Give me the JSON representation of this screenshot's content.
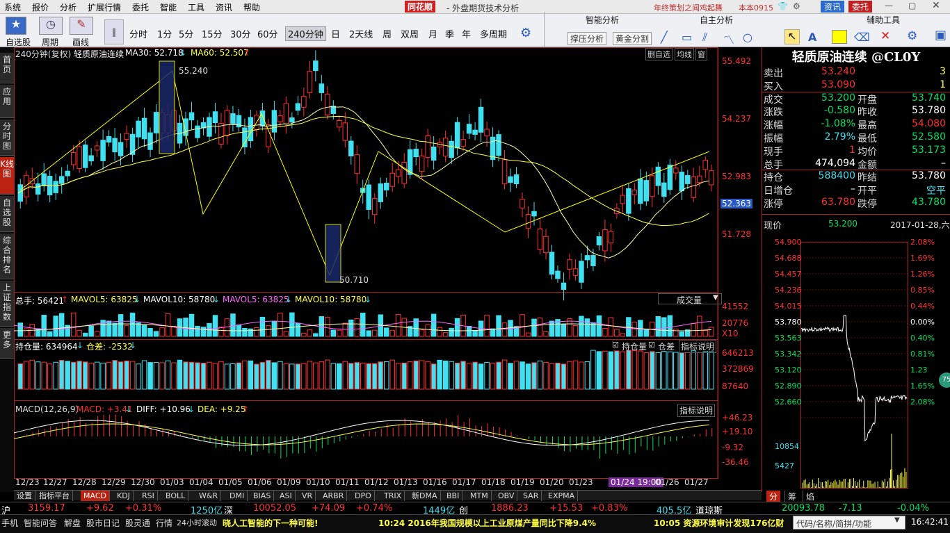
{
  "menu": [
    "系统",
    "报价",
    "分析",
    "扩展行情",
    "委托",
    "智能",
    "工具",
    "资讯",
    "帮助"
  ],
  "app_logo": "同花顺",
  "window_title": "- 外盘期货技术分析",
  "promo": "年终策划之闻鸡起舞",
  "user": "本本0915",
  "btn_zixun": "资讯",
  "btn_weituo": "委托",
  "toolbar": {
    "zixuan": "自选股",
    "zhouqi": "周期",
    "huaxian": "画线",
    "periods": [
      "分时",
      "1分",
      "5分",
      "15分",
      "30分",
      "60分",
      "240分钟",
      "日",
      "2天线",
      "周",
      "双周",
      "月",
      "季",
      "年",
      "多周期"
    ],
    "zhineng_title": "智能分析",
    "yashi": "撑压分析",
    "huangjin": "黄金分割",
    "zizhu_title": "自主分析",
    "fuzhu_title": "辅助工具"
  },
  "sidebar": [
    {
      "label": "首页"
    },
    {
      "label": "应用"
    },
    {
      "label": "分时图"
    },
    {
      "label": "K线图"
    },
    {
      "label": "自选股"
    },
    {
      "label": "综合排名"
    },
    {
      "label": "上证指数"
    },
    {
      "label": "更多"
    }
  ],
  "chart": {
    "header": "240分钟(复权)",
    "name": "轻质原油连续",
    "ma30": "MA30: 52.718",
    "ma60": "MA60: 52.507",
    "top_btns": [
      "删自选",
      "均线",
      "窗"
    ],
    "high_label": "55.240",
    "low_label": "50.710",
    "price_axis": [
      "55.492",
      "54.237",
      "52.983",
      "51.728"
    ],
    "current_price": "52.363",
    "vol_header": {
      "total": "总手: 56421",
      "mavol5": "MAVOL5: 63825",
      "mavol10": "MAVOL10: 58780",
      "mavol5b": "MAVOL5: 63825",
      "mavol10b": "MAVOL10: 58780"
    },
    "vol_dropdown": "成交量",
    "vol_axis": [
      "41552",
      "20776",
      "X10"
    ],
    "oi_header": {
      "oi": "持仓量: 634964",
      "diff": "仓差: -2532"
    },
    "oi_checks": [
      "持仓量",
      "仓差"
    ],
    "oi_help": "指标说明",
    "oi_axis": [
      "646213",
      "372869",
      "87640"
    ],
    "macd_header": {
      "name": "MACD(12,26,9)",
      "macd": "MACD: +3.41",
      "diff": "DIFF: +10.96",
      "dea": "DEA: +9.25"
    },
    "macd_help": "指标说明",
    "macd_axis": [
      "+46.23",
      "+19.10",
      "-9.32",
      "-36.46"
    ],
    "dates": [
      "12/23",
      "12/27",
      "12/28",
      "12/29",
      "12/30",
      "01/03",
      "01/04",
      "01/05",
      "01/06",
      "01/09",
      "01/10",
      "01/11",
      "01/12",
      "01/13",
      "01/16",
      "01/17",
      "01/18",
      "01/19",
      "01/20",
      "01/23",
      "01/24 19:00",
      "01/26",
      "01/27"
    ]
  },
  "bottom_tabs": [
    "设置",
    "指标平台",
    "MACD",
    "KDJ",
    "RSI",
    "BOLL",
    "W&R",
    "DMI",
    "BIAS",
    "ASI",
    "VR",
    "ARBR",
    "DPO",
    "TRIX",
    "新DMA",
    "BBI",
    "MTM",
    "OBV",
    "SAR",
    "EXPMA"
  ],
  "quote": {
    "title": "轻质原油连续 @CL0Y",
    "rows": [
      {
        "l": "卖出",
        "v": "53.240",
        "c": "red",
        "l2": "",
        "v2": "3",
        "c2": "yellow"
      },
      {
        "l": "买入",
        "v": "53.090",
        "c": "red",
        "l2": "",
        "v2": "1",
        "c2": "yellow"
      },
      {
        "l": "成交",
        "v": "53.200",
        "c": "green",
        "l2": "开盘",
        "v2": "53.740",
        "c2": "green"
      },
      {
        "l": "涨跌",
        "v": "-0.580",
        "c": "green",
        "l2": "昨收",
        "v2": "53.780",
        "c2": "white"
      },
      {
        "l": "涨幅",
        "v": "-1.08%",
        "c": "green",
        "l2": "最高",
        "v2": "54.080",
        "c2": "red"
      },
      {
        "l": "振幅",
        "v": "2.79%",
        "c": "cyan",
        "l2": "最低",
        "v2": "52.580",
        "c2": "green"
      },
      {
        "l": "现手",
        "v": "1",
        "c": "red",
        "l2": "均价",
        "v2": "53.173",
        "c2": "green"
      },
      {
        "l": "总手",
        "v": "474,094",
        "c": "white",
        "l2": "金额",
        "v2": "–",
        "c2": "white"
      },
      {
        "l": "持仓",
        "v": "588400",
        "c": "cyan",
        "l2": "昨结",
        "v2": "53.780",
        "c2": "white"
      },
      {
        "l": "日增仓",
        "v": "–",
        "c": "white",
        "l2": "开平",
        "v2": "空平",
        "c2": "cyan"
      },
      {
        "l": "涨停",
        "v": "63.780",
        "c": "red",
        "l2": "跌停",
        "v2": "43.780",
        "c2": "green"
      }
    ],
    "xianjia": "现价",
    "xianjia_val": "53.200",
    "date": "2017-01-28,六",
    "left_axis": [
      "54.900",
      "54.688",
      "54.457",
      "54.236",
      "54.015",
      "53.780",
      "53.563",
      "53.342",
      "53.120",
      "52.890",
      "52.660",
      "10854",
      "5427"
    ],
    "right_axis": [
      "2.08%",
      "1.69%",
      "1.26%",
      "0.85%",
      "0.44%",
      "0.00%",
      "0.40%",
      "0.81%",
      "1.23",
      "1.65%",
      "2.08%"
    ],
    "badge": "75",
    "tabs": [
      "分",
      "筹",
      "焰"
    ]
  },
  "status1": {
    "hu": "沪",
    "hu_v": "3159.17",
    "hu_c": "+9.62",
    "hu_p": "+0.31%",
    "hu_amt": "1250亿",
    "shen": "深",
    "shen_v": "10052.05",
    "shen_c": "+74.09",
    "shen_p": "+0.74%",
    "shen_amt": "1449亿",
    "chuang": "创",
    "chuang_v": "1886.23",
    "chuang_c": "+15.53",
    "chuang_p": "+0.83%",
    "chuang_amt": "405.5亿",
    "dao": "道琼斯",
    "dao_v": "20093.78",
    "dao_c": "-7.13",
    "dao_p": "-0.04%"
  },
  "status2": {
    "items": [
      "手机",
      "智能问答",
      "解盘",
      "股市日记",
      "股灵通",
      "行情",
      "24小时滚动"
    ],
    "news1": "晓人工智能的下一种可能!",
    "news2": "10:24 2016年我国规模以上工业原煤产量同比下降9.4%",
    "news3": "10:05 资源环境审计发现176亿财",
    "search": "代码/名称/简拼/功能",
    "time": "16:42:41"
  },
  "colors": {
    "up": "#ff3030",
    "down": "#40e0f0",
    "ma": "#ffff44",
    "zig": "#ffff00"
  }
}
